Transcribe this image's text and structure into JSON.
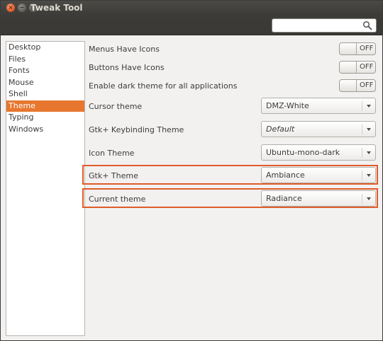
{
  "window": {
    "title": "Tweak Tool",
    "close_glyph": "×",
    "min_glyph": "−",
    "max_glyph": "□"
  },
  "search": {
    "placeholder": "",
    "icon": "search-icon"
  },
  "sidebar": {
    "items": [
      {
        "label": "Desktop"
      },
      {
        "label": "Files"
      },
      {
        "label": "Fonts"
      },
      {
        "label": "Mouse"
      },
      {
        "label": "Shell"
      },
      {
        "label": "Theme",
        "active": true
      },
      {
        "label": "Typing"
      },
      {
        "label": "Windows"
      }
    ]
  },
  "settings": {
    "menus_icons": {
      "label": "Menus Have Icons",
      "state": "OFF"
    },
    "buttons_icons": {
      "label": "Buttons Have Icons",
      "state": "OFF"
    },
    "dark_theme": {
      "label": "Enable dark theme for all applications",
      "state": "OFF"
    },
    "cursor_theme": {
      "label": "Cursor theme",
      "value": "DMZ-White"
    },
    "keybinding_theme": {
      "label": "Gtk+ Keybinding Theme",
      "value": "Default"
    },
    "icon_theme": {
      "label": "Icon Theme",
      "value": "Ubuntu-mono-dark"
    },
    "gtk_theme": {
      "label": "Gtk+ Theme",
      "value": "Ambiance"
    },
    "current_theme": {
      "label": "Current theme",
      "value": "Radiance"
    }
  },
  "colors": {
    "accent": "#e7772f",
    "highlight_border": "#e05c2a",
    "titlebar": "#3c3b37"
  }
}
